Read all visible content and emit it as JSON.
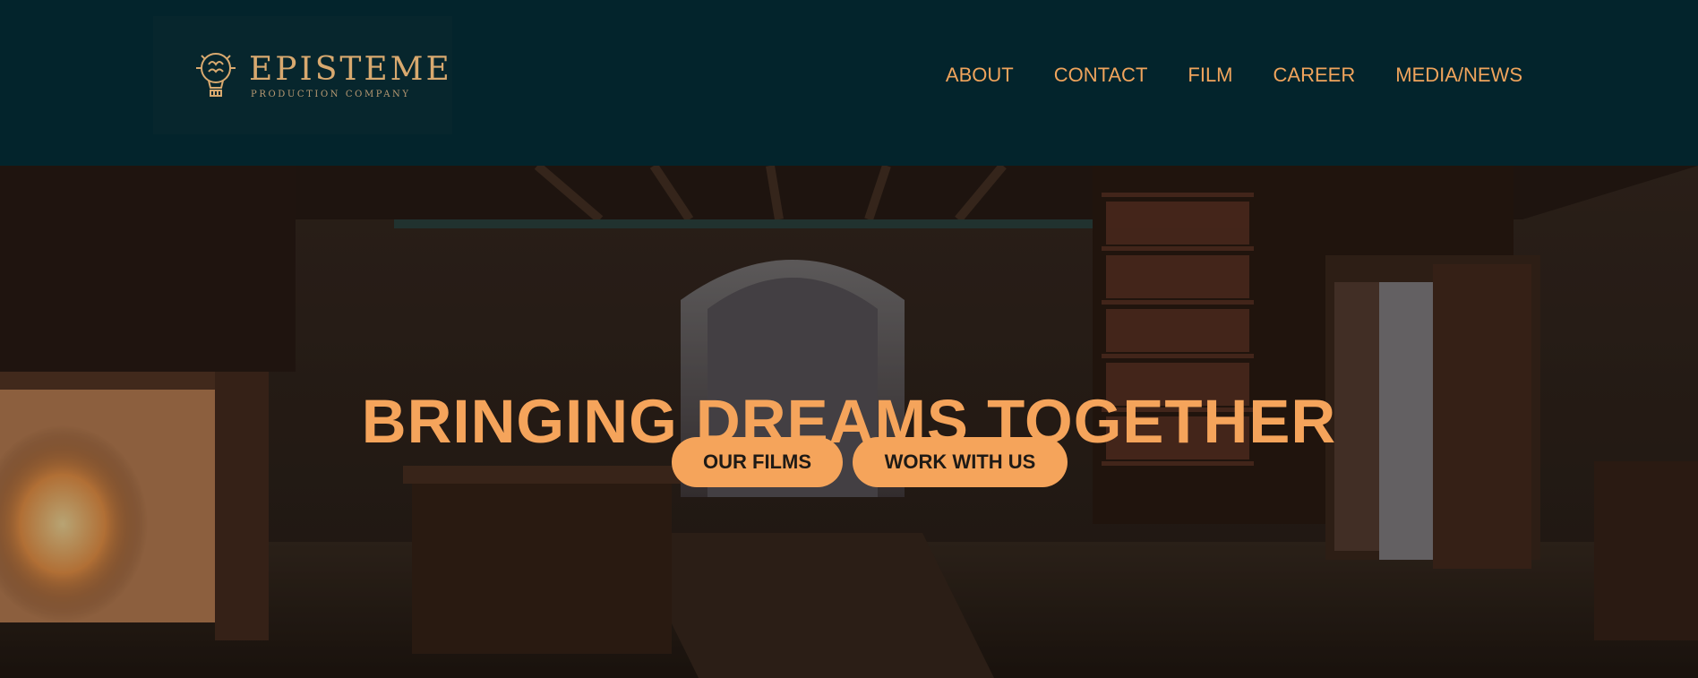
{
  "brand": {
    "name": "EPISTEME",
    "tagline": "PRODUCTION COMPANY",
    "accent_color": "#f5a45b",
    "header_bg": "#03242c"
  },
  "nav": {
    "items": [
      {
        "label": "ABOUT"
      },
      {
        "label": "CONTACT"
      },
      {
        "label": "FILM"
      },
      {
        "label": "CAREER"
      },
      {
        "label": "MEDIA/NEWS"
      }
    ]
  },
  "hero": {
    "title": "BRINGING DREAMS TOGETHER",
    "primary_button": "OUR FILMS",
    "secondary_button": "WORK WITH US"
  }
}
